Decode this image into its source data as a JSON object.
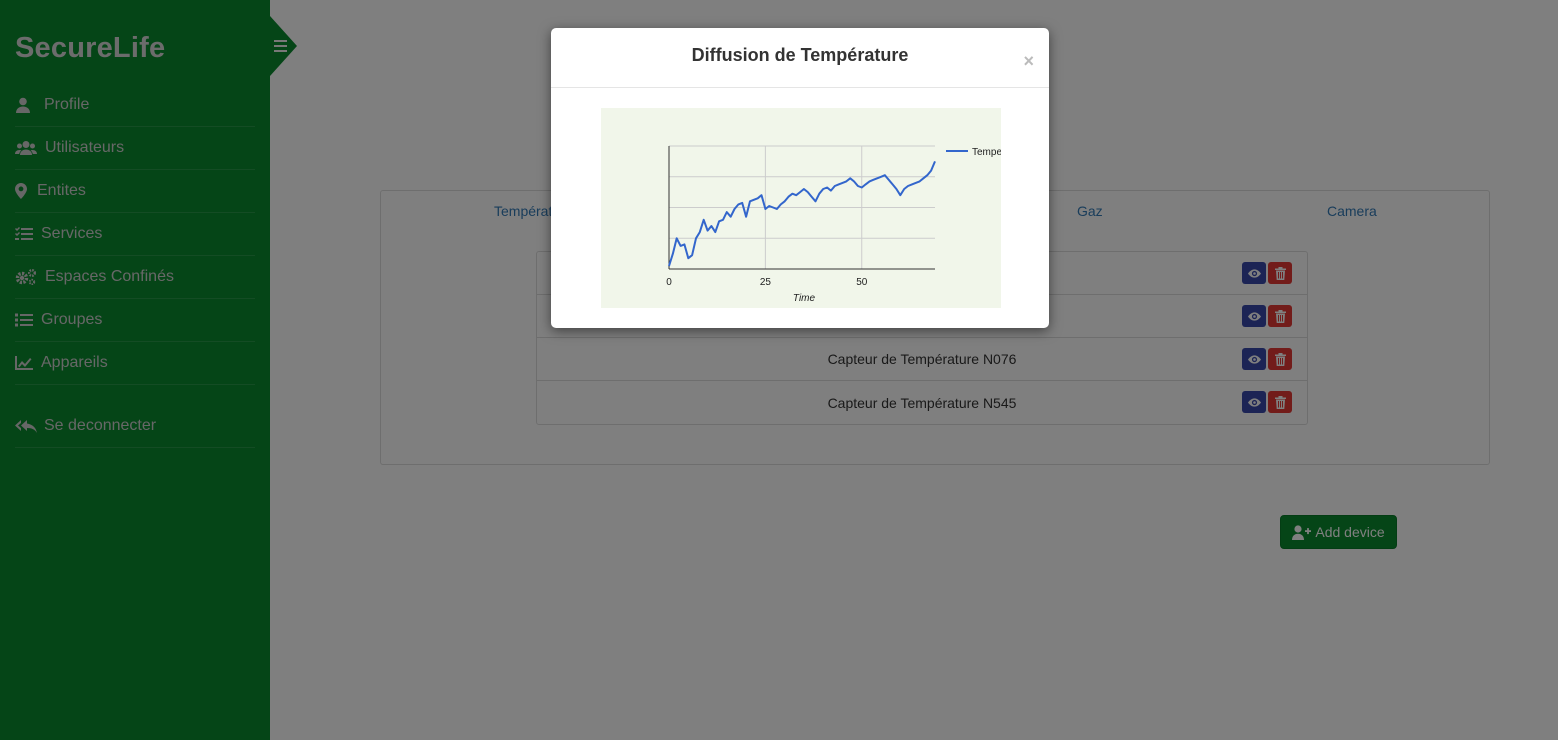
{
  "app": {
    "brand": "SecureLife"
  },
  "sidebar": {
    "items": [
      {
        "label": "Profile",
        "icon": "user-icon"
      },
      {
        "label": "Utilisateurs",
        "icon": "users-icon"
      },
      {
        "label": "Entites",
        "icon": "map-marker-icon"
      },
      {
        "label": "Services",
        "icon": "tasks-icon"
      },
      {
        "label": "Espaces Confinés",
        "icon": "cogs-icon"
      },
      {
        "label": "Groupes",
        "icon": "list-icon"
      },
      {
        "label": "Appareils",
        "icon": "line-chart-icon"
      }
    ],
    "logout": {
      "label": "Se deconnecter",
      "icon": "reply-all-icon"
    }
  },
  "tabs": [
    "Températ",
    "Gaz",
    "Camera"
  ],
  "devices": [
    {
      "name": ""
    },
    {
      "name": ""
    },
    {
      "name": "Capteur de Température N076"
    },
    {
      "name": "Capteur de Température N545"
    }
  ],
  "add_device": {
    "label": "Add device"
  },
  "modal": {
    "title": "Diffusion de Température",
    "close": "×"
  },
  "colors": {
    "sidebar": "#0a8a2e",
    "series_line": "#3366cc",
    "chart_bg": "#f1f6ea",
    "view_button": "#3949ab",
    "delete_button": "#e53935"
  },
  "chart_data": {
    "type": "line",
    "xlabel": "Time",
    "ylabel": "",
    "xticks": [
      "0",
      "25",
      "50"
    ],
    "xlim": [
      0,
      69
    ],
    "ylim": [
      0,
      4
    ],
    "grid": true,
    "legend_position": "right",
    "series": [
      {
        "name": "Tempe",
        "x": [
          0,
          1,
          2,
          3,
          4,
          5,
          6,
          7,
          8,
          9,
          10,
          11,
          12,
          13,
          14,
          15,
          16,
          17,
          18,
          19,
          20,
          21,
          22,
          23,
          24,
          25,
          26,
          27,
          28,
          29,
          30,
          31,
          32,
          33,
          34,
          35,
          36,
          37,
          38,
          39,
          40,
          41,
          42,
          43,
          44,
          45,
          46,
          47,
          48,
          49,
          50,
          51,
          52,
          53,
          54,
          55,
          56,
          57,
          58,
          59,
          60,
          61,
          62,
          63,
          64,
          65,
          66,
          67,
          68,
          69
        ],
        "y": [
          0.1,
          0.5,
          1.0,
          0.75,
          0.8,
          0.35,
          0.45,
          1.0,
          1.2,
          1.6,
          1.25,
          1.4,
          1.2,
          1.55,
          1.6,
          1.85,
          1.7,
          1.95,
          2.1,
          2.15,
          1.7,
          2.2,
          2.25,
          2.3,
          2.4,
          1.95,
          2.05,
          2.0,
          1.95,
          2.1,
          2.2,
          2.35,
          2.45,
          2.4,
          2.5,
          2.6,
          2.5,
          2.35,
          2.2,
          2.45,
          2.6,
          2.65,
          2.55,
          2.7,
          2.75,
          2.8,
          2.85,
          2.95,
          2.85,
          2.7,
          2.65,
          2.75,
          2.85,
          2.9,
          2.95,
          3.0,
          3.05,
          2.9,
          2.75,
          2.6,
          2.4,
          2.6,
          2.7,
          2.75,
          2.8,
          2.85,
          2.95,
          3.05,
          3.2,
          3.5
        ]
      }
    ]
  }
}
